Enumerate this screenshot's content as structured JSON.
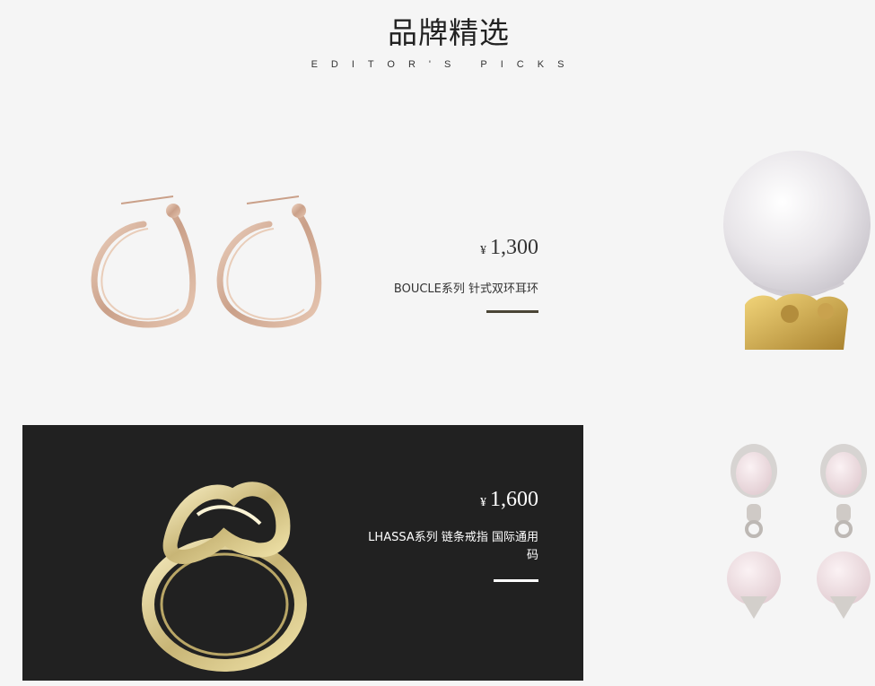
{
  "header": {
    "title": "品牌精选",
    "subtitle": "EDITOR'S PICKS"
  },
  "products": [
    {
      "price_symbol": "¥",
      "price": "1,300",
      "name": "BOUCLE系列 针式双环耳环",
      "image_icon": "hoop-earrings-image"
    },
    {
      "price_symbol": "¥",
      "price": "1,600",
      "name": "LHASSA系列 链条戒指 国际通用码",
      "image_icon": "chain-ring-image"
    }
  ],
  "side_items": [
    {
      "image_icon": "crystal-ball-lion-image"
    },
    {
      "image_icon": "pink-stone-earrings-image"
    }
  ],
  "colors": {
    "background": "#f5f5f5",
    "dark_card": "#212121",
    "accent_bar": "#4a4536",
    "rose_gold": "#d8b49c",
    "gold": "#d9c98c"
  }
}
